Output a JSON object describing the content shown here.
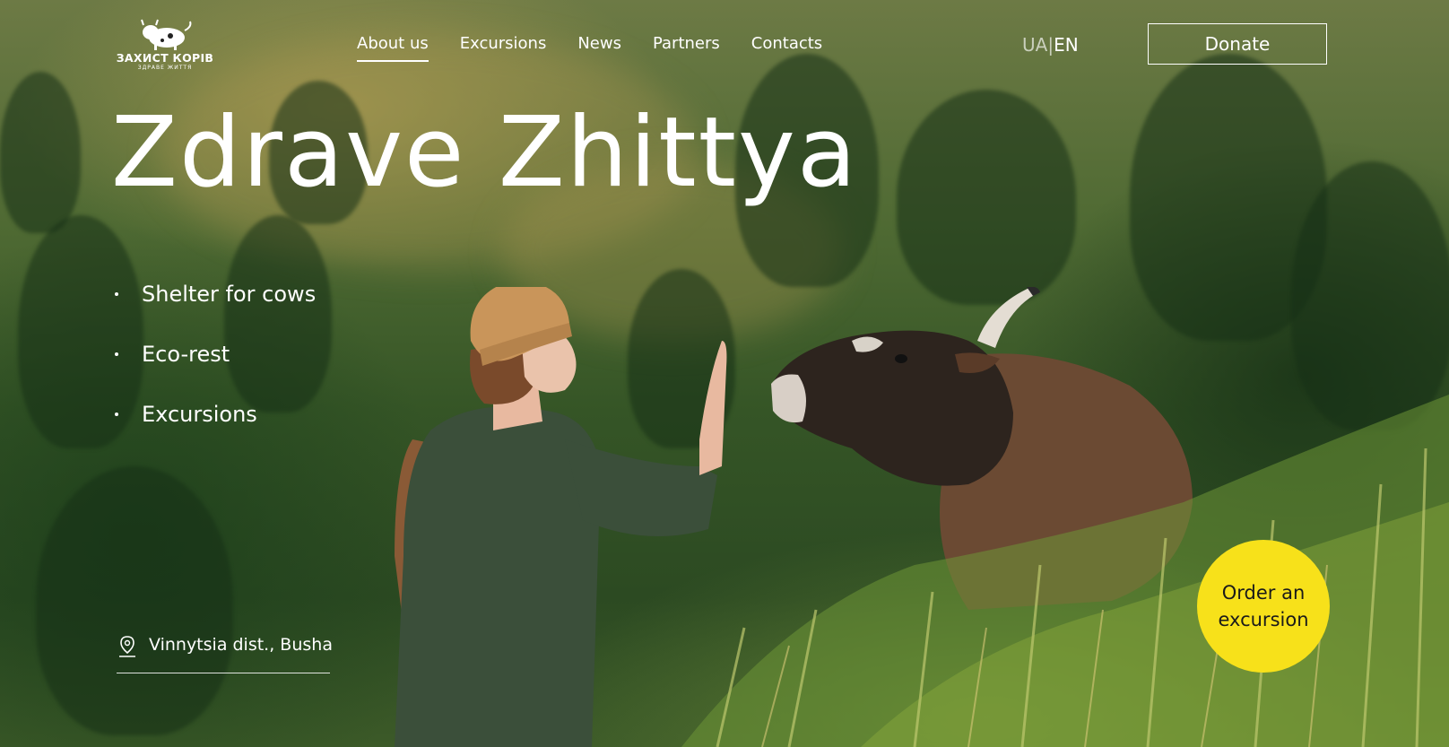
{
  "logo": {
    "text": "ЗАХИСТ КОРІВ",
    "sub": "ЗДРАВЕ ЖИТТЯ",
    "icon": "cow-icon"
  },
  "nav": {
    "items": [
      {
        "label": "About us",
        "active": true
      },
      {
        "label": "Excursions",
        "active": false
      },
      {
        "label": "News",
        "active": false
      },
      {
        "label": "Partners",
        "active": false
      },
      {
        "label": "Contacts",
        "active": false
      }
    ]
  },
  "lang": {
    "ua": "UA",
    "separator": "|",
    "en": "EN",
    "selected": "EN"
  },
  "donate_label": "Donate",
  "hero": {
    "title": "Zdrave Zhittya",
    "features": [
      "Shelter for cows",
      "Eco-rest",
      "Excursions"
    ]
  },
  "location": {
    "text": "Vinnytsia dist., Busha",
    "icon": "location-pin-icon"
  },
  "order_label": "Order an excursion",
  "colors": {
    "accent_yellow": "#f7e11a",
    "text": "#ffffff"
  }
}
